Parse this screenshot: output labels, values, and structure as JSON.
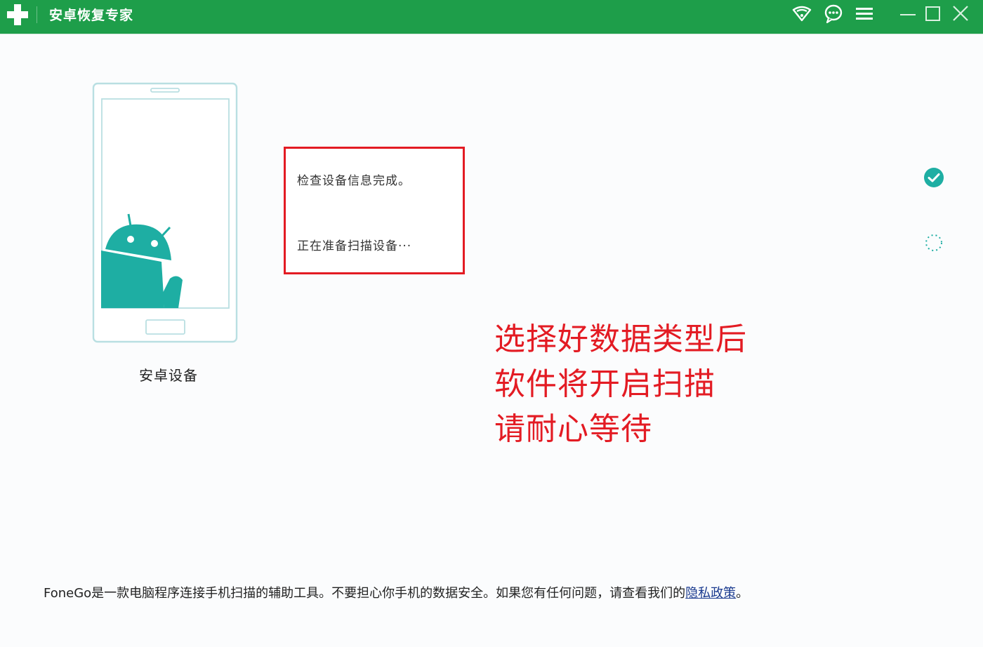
{
  "titlebar": {
    "title": "安卓恢复专家",
    "icons": [
      "plus-logo-icon",
      "wifi-icon",
      "chat-icon",
      "menu-icon",
      "minimize-icon",
      "maximize-icon",
      "close-icon"
    ],
    "accent_color": "#1e9e4a"
  },
  "device": {
    "label": "安卓设备",
    "icon": "android-icon",
    "icon_color": "#1eaea3"
  },
  "status": {
    "line1": "检查设备信息完成。",
    "line2": "正在准备扫描设备···",
    "border_color": "#e31b23"
  },
  "steps": [
    {
      "state": "done",
      "icon": "check-circle-icon"
    },
    {
      "state": "loading",
      "icon": "spinner-icon"
    }
  ],
  "annotation": {
    "lines": [
      "选择好数据类型后",
      "软件将开启扫描",
      "请耐心等待"
    ],
    "color": "#e31b23"
  },
  "footer": {
    "text": "FoneGo是一款电脑程序连接手机扫描的辅助工具。不要担心你手机的数据安全。如果您有任何问题，请查看我们的",
    "link_text": "隐私政策",
    "end": "。"
  }
}
